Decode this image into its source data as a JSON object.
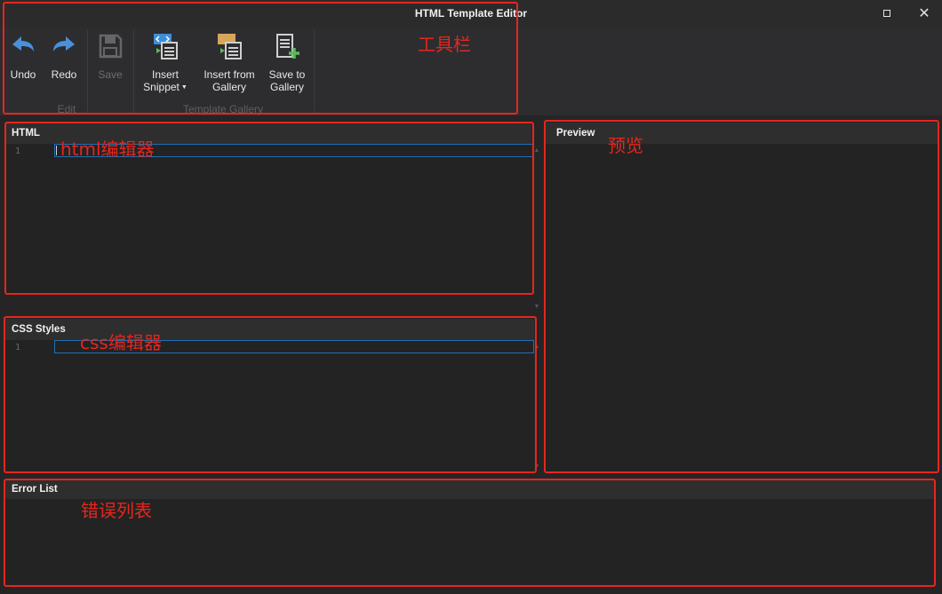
{
  "window": {
    "title": "HTML Template Editor"
  },
  "toolbar": {
    "undo_label": "Undo",
    "redo_label": "Redo",
    "save_label": "Save",
    "insert_snippet_line1": "Insert",
    "insert_snippet_line2": "Snippet",
    "insert_gallery_line1": "Insert from",
    "insert_gallery_line2": "Gallery",
    "save_gallery_line1": "Save to",
    "save_gallery_line2": "Gallery",
    "group_edit": "Edit",
    "group_gallery": "Template Gallery"
  },
  "html_panel": {
    "title": "HTML",
    "line": "1"
  },
  "css_panel": {
    "title": "CSS Styles",
    "line": "1"
  },
  "preview_panel": {
    "title": "Preview"
  },
  "errors_panel": {
    "title": "Error List"
  },
  "annotations": {
    "toolbar": "工具栏",
    "html_editor": "html编辑器",
    "css_editor": "css编辑器",
    "preview": "预览",
    "error_list": "错误列表"
  },
  "colors": {
    "annotation": "#e5261e",
    "accent": "#1f6fb5",
    "background": "#252526"
  }
}
